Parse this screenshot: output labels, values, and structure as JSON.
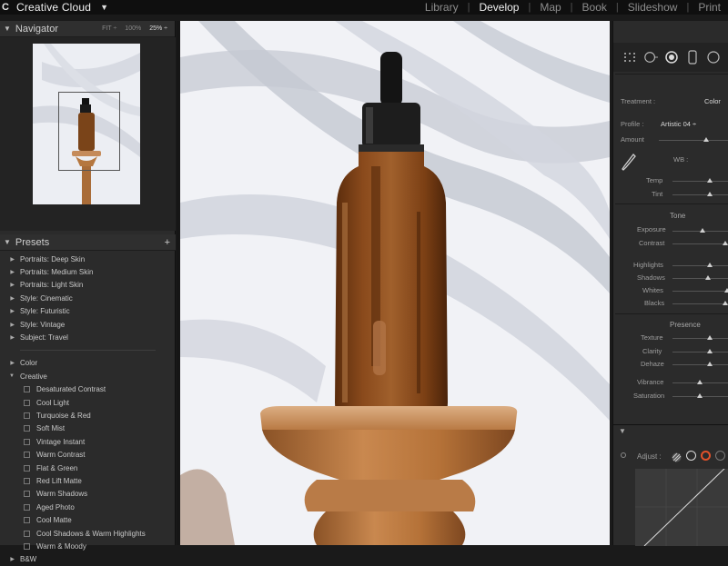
{
  "app": {
    "title": "Creative Cloud"
  },
  "modules": [
    "Library",
    "Develop",
    "Map",
    "Book",
    "Slideshow",
    "Print"
  ],
  "navigator": {
    "title": "Navigator",
    "options": [
      "FIT ÷",
      "100%",
      "25% ÷"
    ]
  },
  "presets": {
    "title": "Presets",
    "groups": [
      "Portraits: Deep Skin",
      "Portraits: Medium Skin",
      "Portraits: Light Skin",
      "Style: Cinematic",
      "Style: Futuristic",
      "Style: Vintage",
      "Subject: Travel"
    ],
    "sections": [
      "Color",
      "Creative"
    ],
    "creative_items": [
      "Desaturated Contrast",
      "Cool Light",
      "Turquoise & Red",
      "Soft Mist",
      "Vintage Instant",
      "Warm Contrast",
      "Flat & Green",
      "Red Lift Matte",
      "Warm Shadows",
      "Aged Photo",
      "Cool Matte",
      "Cool Shadows & Warm Highlights",
      "Warm & Moody"
    ],
    "last_section": "B&W"
  },
  "basic": {
    "treatment_label": "Treatment :",
    "treatment_value": "Color",
    "profile_label": "Profile :",
    "profile_value": "Artistic 04 ÷",
    "amount_label": "Amount",
    "wb_label": "WB :",
    "temp_label": "Temp",
    "tint_label": "Tint",
    "tone_title": "Tone",
    "exposure_label": "Exposure",
    "contrast_label": "Contrast",
    "highlights_label": "Highlights",
    "shadows_label": "Shadows",
    "whites_label": "Whites",
    "blacks_label": "Blacks",
    "presence_title": "Presence",
    "texture_label": "Texture",
    "clarity_label": "Clarity",
    "dehaze_label": "Dehaze",
    "vibrance_label": "Vibrance",
    "saturation_label": "Saturation"
  },
  "tone_curve": {
    "adjust_label": "Adjust :"
  },
  "colors": {
    "accent": "#e3522a",
    "panel": "#2b2b2b",
    "topbar": "#0f0f0f"
  }
}
